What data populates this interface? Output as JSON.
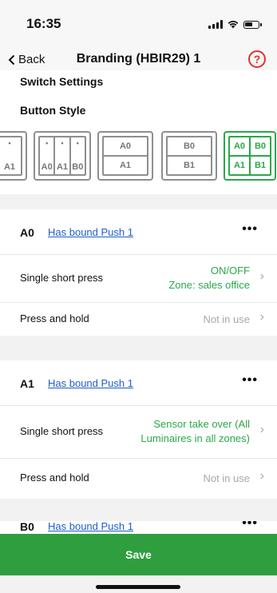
{
  "status_bar": {
    "time": "16:35"
  },
  "nav": {
    "back_label": "Back",
    "title": "Branding (HBIR29) 1",
    "help_symbol": "?"
  },
  "section": {
    "switch_settings": "Switch Settings",
    "button_style": "Button Style"
  },
  "button_styles": [
    {
      "cells": [
        "A1"
      ],
      "selected": false
    },
    {
      "cells": [
        "A0",
        "A1",
        "B0"
      ],
      "selected": false
    },
    {
      "top": "A0",
      "bottom": "A1",
      "selected": false
    },
    {
      "top": "B0",
      "bottom": "B1",
      "selected": false
    },
    {
      "top_left": "A0",
      "top_right": "B0",
      "bottom_left": "A1",
      "bottom_right": "B1",
      "selected": true
    }
  ],
  "cards": [
    {
      "id": "A0",
      "link": "Has bound Push 1",
      "more": "•••",
      "rows": [
        {
          "label": "Single short press",
          "value_line1": "ON/OFF",
          "value_line2": "Zone: sales office",
          "state": "active"
        },
        {
          "label": "Press and hold",
          "value_line1": "Not in use",
          "value_line2": "",
          "state": "inactive"
        }
      ]
    },
    {
      "id": "A1",
      "link": "Has bound Push 1",
      "more": "•••",
      "rows": [
        {
          "label": "Single short press",
          "value_line1": "Sensor take over (All",
          "value_line2": "Luminaires in all zones)",
          "state": "active"
        },
        {
          "label": "Press and hold",
          "value_line1": "Not in use",
          "value_line2": "",
          "state": "inactive"
        }
      ]
    },
    {
      "id": "B0",
      "link": "Has bound Push 1",
      "more": "•••",
      "rows": []
    }
  ],
  "footer": {
    "save_label": "Save"
  },
  "colors": {
    "accent_green": "#2aa84a",
    "save_green": "#2f9e3f",
    "link_blue": "#1f5ec8",
    "help_red": "#e8302a"
  }
}
